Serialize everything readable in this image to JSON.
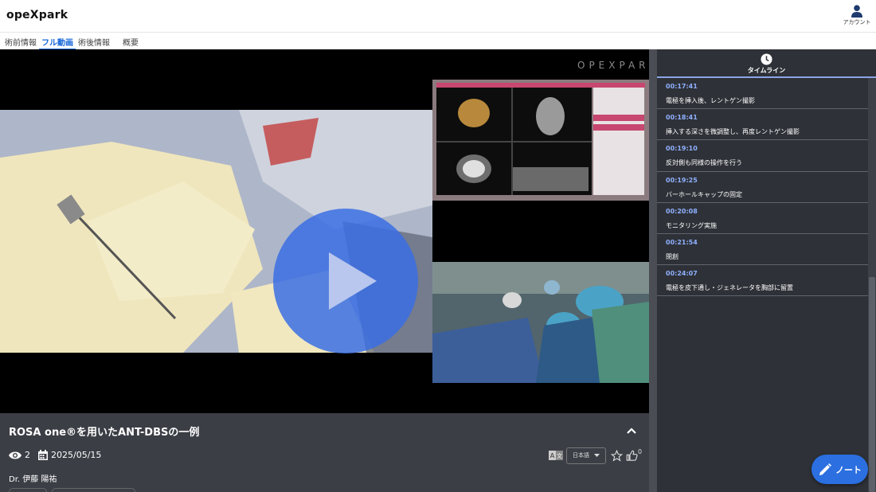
{
  "app": {
    "title": "opeXpark"
  },
  "header": {
    "account_label": "アカウント",
    "account_icon": "user-icon"
  },
  "tabs": [
    {
      "label": "術前情報",
      "active": false
    },
    {
      "label": "フル動画",
      "active": true
    },
    {
      "label": "術後情報",
      "active": false
    },
    {
      "label": "概要",
      "active": false
    }
  ],
  "video": {
    "watermark": "OPEXPARK",
    "play_icon": "play-icon"
  },
  "details": {
    "title": "ROSA one®を用いたANT-DBSの一例",
    "views": "2",
    "date": "2025/05/15",
    "doctor": "Dr. 伊藤 陽祐",
    "language": "日本語",
    "likes": "0",
    "icons": [
      "eye-icon",
      "calendar-icon",
      "translate-icon",
      "star-icon",
      "thumbs-up-icon",
      "chevron-up-icon"
    ]
  },
  "timeline": {
    "title": "タイムライン",
    "icon": "clock-icon",
    "items": [
      {
        "time": "00:17:41",
        "text": "電極を挿入後、レントゲン撮影"
      },
      {
        "time": "00:18:41",
        "text": "挿入する深さを微調整し、再度レントゲン撮影"
      },
      {
        "time": "00:19:10",
        "text": "反対側も同様の操作を行う"
      },
      {
        "time": "00:19:25",
        "text": "バーホールキャップの固定"
      },
      {
        "time": "00:20:08",
        "text": "モニタリング実施"
      },
      {
        "time": "00:21:54",
        "text": "閉創"
      },
      {
        "time": "00:24:07",
        "text": "電極を皮下通し・ジェネレータを胸部に留置"
      }
    ]
  },
  "note": {
    "label": "ノート",
    "icon": "pencil-icon"
  },
  "colors": {
    "accent": "#1565d8",
    "fab": "#2b6fe0",
    "timeline_time": "#8fb0ff",
    "panel": "#2e3137"
  }
}
